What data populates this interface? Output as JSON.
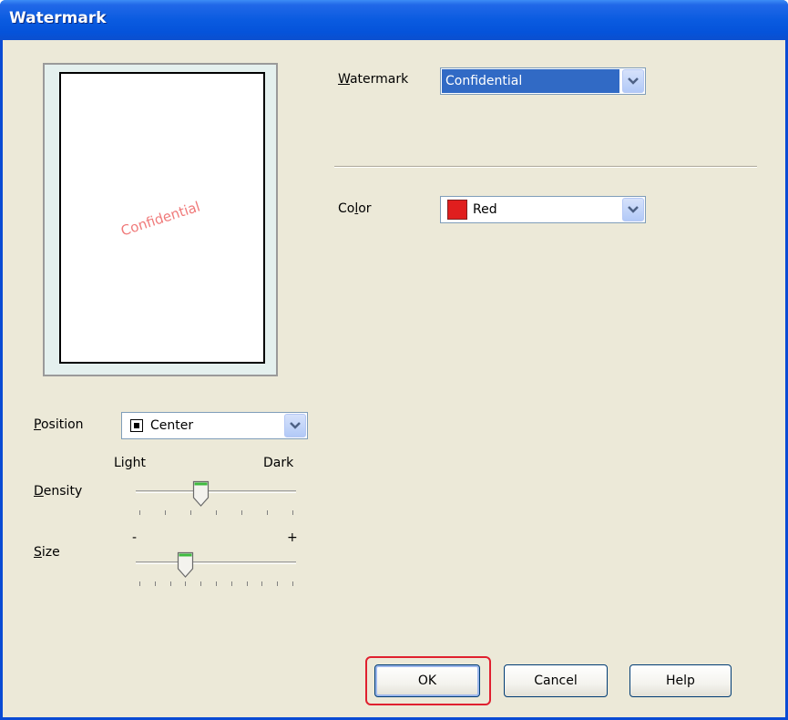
{
  "window": {
    "title": "Watermark"
  },
  "preview": {
    "watermark_text": "Confidential"
  },
  "watermark": {
    "label": "Watermark",
    "mnemonic": "W",
    "value": "Confidential"
  },
  "color": {
    "label": "Color",
    "mnemonic": "l",
    "value": "Red",
    "swatch": "#e01e1e"
  },
  "position": {
    "label": "Position",
    "mnemonic": "P",
    "value": "Center"
  },
  "density": {
    "label": "Density",
    "mnemonic": "D",
    "min_label": "Light",
    "max_label": "Dark",
    "level": 0.4
  },
  "size": {
    "label": "Size",
    "mnemonic": "S",
    "min_label": "-",
    "max_label": "+",
    "level": 0.3
  },
  "buttons": {
    "ok": "OK",
    "cancel": "Cancel",
    "help": "Help"
  },
  "colors": {
    "titlebar": "#0553da",
    "face": "#ece9d8",
    "highlight": "#e0202f"
  }
}
